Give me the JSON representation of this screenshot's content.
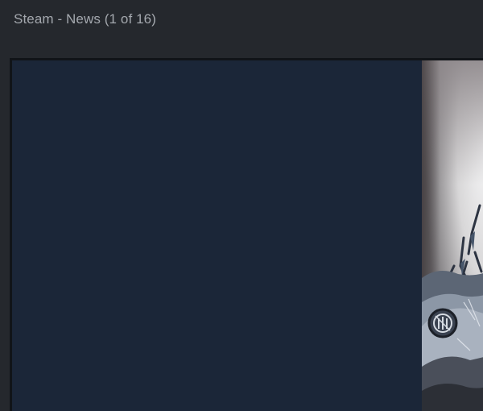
{
  "window": {
    "title": "Steam - News (1 of 16)"
  },
  "news_image": {
    "icon": "news-artwork-image"
  }
}
